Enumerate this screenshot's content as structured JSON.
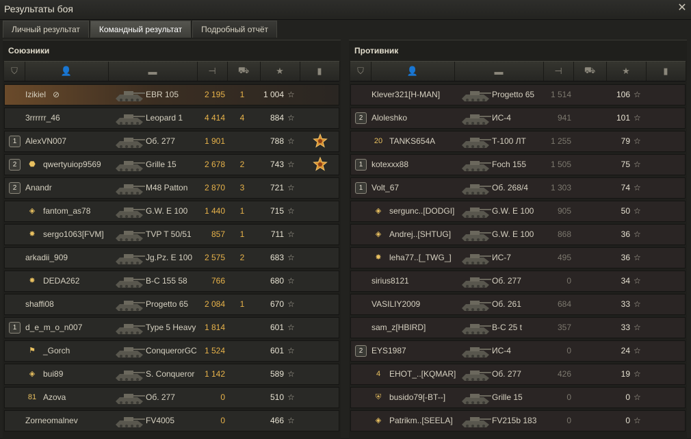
{
  "window": {
    "title": "Результаты боя",
    "close_icon": "close-icon"
  },
  "tabs": [
    {
      "label": "Личный результат",
      "active": false
    },
    {
      "label": "Командный результат",
      "active": true
    },
    {
      "label": "Подробный отчёт",
      "active": false
    }
  ],
  "columns": [
    "platoon-icon",
    "player-icon",
    "tank-icon",
    "damage-icon",
    "kills-icon",
    "xp-star-icon",
    "medal-icon"
  ],
  "allies": {
    "title": "Союзники",
    "rows": [
      {
        "platoon": "",
        "badge": "",
        "name": "Izikiel",
        "hidden_icon": true,
        "vehicle": "EBR 105",
        "damage": "2 195",
        "kills": "1",
        "xp": "1 004",
        "medal": "",
        "me": true
      },
      {
        "platoon": "",
        "badge": "",
        "name": "3rrrrrr_46",
        "vehicle": "Leopard 1",
        "damage": "4 414",
        "kills": "4",
        "xp": "884",
        "medal": ""
      },
      {
        "platoon": "1",
        "badge": "",
        "name": "AlexVN007",
        "vehicle": "Об. 277",
        "damage": "1 901",
        "kills": "",
        "xp": "788",
        "medal": "order-medal-icon"
      },
      {
        "platoon": "2",
        "badge": "rank-badge-icon",
        "name": "qwertyuiop9569",
        "vehicle": "Grille 15",
        "damage": "2 678",
        "kills": "2",
        "xp": "743",
        "medal": "order-medal-icon"
      },
      {
        "platoon": "2",
        "badge": "",
        "name": "Anandr",
        "vehicle": "M48 Patton",
        "damage": "2 870",
        "kills": "3",
        "xp": "721",
        "medal": ""
      },
      {
        "platoon": "",
        "badge": "diamond-rank-icon",
        "name": "fantom_as78",
        "vehicle": "G.W. E 100",
        "damage": "1 440",
        "kills": "1",
        "xp": "715",
        "medal": ""
      },
      {
        "platoon": "",
        "badge": "star-rank-icon",
        "name": "sergo1063[FVM]",
        "vehicle": "TVP T 50/51",
        "damage": "857",
        "kills": "1",
        "xp": "711",
        "medal": ""
      },
      {
        "platoon": "",
        "badge": "",
        "name": "arkadii_909",
        "vehicle": "Jg.Pz. E 100",
        "damage": "2 575",
        "kills": "2",
        "xp": "683",
        "medal": ""
      },
      {
        "platoon": "",
        "badge": "star-rank-icon",
        "name": "DEDA262",
        "vehicle": "B-C 155 58",
        "damage": "766",
        "kills": "",
        "xp": "680",
        "medal": ""
      },
      {
        "platoon": "",
        "badge": "",
        "name": "shaffi08",
        "vehicle": "Progetto 65",
        "damage": "2 084",
        "kills": "1",
        "xp": "670",
        "medal": ""
      },
      {
        "platoon": "1",
        "badge": "",
        "name": "d_e_m_o_n007",
        "vehicle": "Type 5 Heavy",
        "damage": "1 814",
        "kills": "",
        "xp": "601",
        "medal": ""
      },
      {
        "platoon": "",
        "badge": "flag-rank-icon",
        "name": "_Gorch",
        "vehicle": "ConquerorGC",
        "damage": "1 524",
        "kills": "",
        "xp": "601",
        "medal": ""
      },
      {
        "platoon": "",
        "badge": "diamond-rank-icon",
        "name": "bui89",
        "vehicle": "S. Conqueror",
        "damage": "1 142",
        "kills": "",
        "xp": "589",
        "medal": ""
      },
      {
        "platoon": "",
        "badge": "number-rank-icon",
        "badge_text": "81",
        "name": "Azova",
        "vehicle": "Об. 277",
        "damage": "0",
        "kills": "",
        "xp": "510",
        "medal": ""
      },
      {
        "platoon": "",
        "badge": "",
        "name": "Zorneomalnev",
        "vehicle": "FV4005",
        "damage": "0",
        "kills": "",
        "xp": "466",
        "medal": ""
      }
    ]
  },
  "enemies": {
    "title": "Противник",
    "rows": [
      {
        "platoon": "",
        "badge": "",
        "name": "Klever321[H-MAN]",
        "vehicle": "Progetto 65",
        "damage": "1 514",
        "xp": "106"
      },
      {
        "platoon": "2",
        "badge": "",
        "name": "Aloleshko",
        "vehicle": "ИС-4",
        "damage": "941",
        "xp": "101"
      },
      {
        "platoon": "",
        "badge": "number-rank-icon",
        "badge_text": "20",
        "name": "TANKS654A",
        "vehicle": "Т-100 ЛТ",
        "damage": "1 255",
        "xp": "79"
      },
      {
        "platoon": "1",
        "badge": "",
        "name": "kotexxx88",
        "vehicle": "Foch 155",
        "damage": "1 505",
        "xp": "75"
      },
      {
        "platoon": "1",
        "badge": "",
        "name": "Volt_67",
        "vehicle": "Об. 268/4",
        "damage": "1 303",
        "xp": "74"
      },
      {
        "platoon": "",
        "badge": "diamond-rank-icon",
        "name": "sergunc..[DODGI]",
        "vehicle": "G.W. E 100",
        "damage": "905",
        "xp": "50"
      },
      {
        "platoon": "",
        "badge": "diamond-rank-icon",
        "name": "Andrej..[SHTUG]",
        "vehicle": "G.W. E 100",
        "damage": "868",
        "xp": "36"
      },
      {
        "platoon": "",
        "badge": "star-rank-icon",
        "name": "leha77..[_TWG_]",
        "vehicle": "ИС-7",
        "damage": "495",
        "xp": "36"
      },
      {
        "platoon": "",
        "badge": "",
        "name": "sirius8121",
        "vehicle": "Об. 277",
        "damage": "0",
        "xp": "34"
      },
      {
        "platoon": "",
        "badge": "",
        "name": "VASILIY2009",
        "vehicle": "Об. 261",
        "damage": "684",
        "xp": "33"
      },
      {
        "platoon": "",
        "badge": "",
        "name": "sam_z[HBIRD]",
        "vehicle": "B-C 25 t",
        "damage": "357",
        "xp": "33"
      },
      {
        "platoon": "2",
        "badge": "",
        "name": "EYS1987",
        "vehicle": "ИС-4",
        "damage": "0",
        "xp": "24"
      },
      {
        "platoon": "",
        "badge": "number-rank-icon",
        "badge_text": "4",
        "name": "ЕНОТ_..[KQMAR]",
        "vehicle": "Об. 277",
        "damage": "426",
        "xp": "19"
      },
      {
        "platoon": "",
        "badge": "shield-rank-icon",
        "name": "busido79[-BT--]",
        "vehicle": "Grille 15",
        "damage": "0",
        "xp": "0"
      },
      {
        "platoon": "",
        "badge": "diamond-rank-icon",
        "name": "Patrikm..[SEELA]",
        "vehicle": "FV215b 183",
        "damage": "0",
        "xp": "0"
      }
    ]
  },
  "colors": {
    "accent_damage": "#e8b34a",
    "highlight_row": "#6a4a2a"
  },
  "star_glyph": "☆"
}
